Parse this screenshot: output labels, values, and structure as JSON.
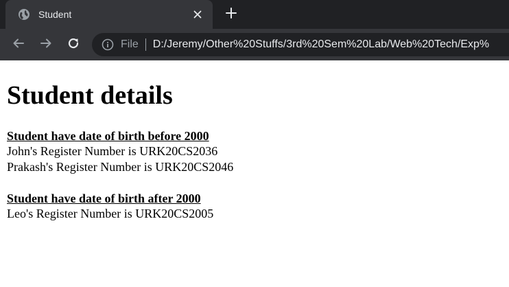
{
  "browser": {
    "tab": {
      "title": "Student",
      "favicon": "globe-icon",
      "close_icon": "close-icon"
    },
    "new_tab_icon": "plus-icon",
    "nav": {
      "back_icon": "arrow-left-icon",
      "forward_icon": "arrow-right-icon",
      "reload_icon": "reload-icon"
    },
    "address_bar": {
      "info_icon": "info-icon",
      "scheme_label": "File",
      "url": "D:/Jeremy/Other%20Stuffs/3rd%20Sem%20Lab/Web%20Tech/Exp%"
    },
    "colors": {
      "tabstrip_bg": "#202124",
      "tab_bg": "#35363a",
      "toolbar_bg": "#35363a",
      "omnibox_bg": "#202124",
      "text_light": "#e8eaed",
      "text_muted": "#9aa0a6"
    }
  },
  "page": {
    "heading": "Student details",
    "sections": [
      {
        "heading": "Student have date of birth before 2000",
        "lines": [
          "John's Register Number is URK20CS2036",
          "Prakash's Register Number is URK20CS2046"
        ]
      },
      {
        "heading": "Student have date of birth after 2000",
        "lines": [
          "Leo's Register Number is URK20CS2005"
        ]
      }
    ]
  }
}
